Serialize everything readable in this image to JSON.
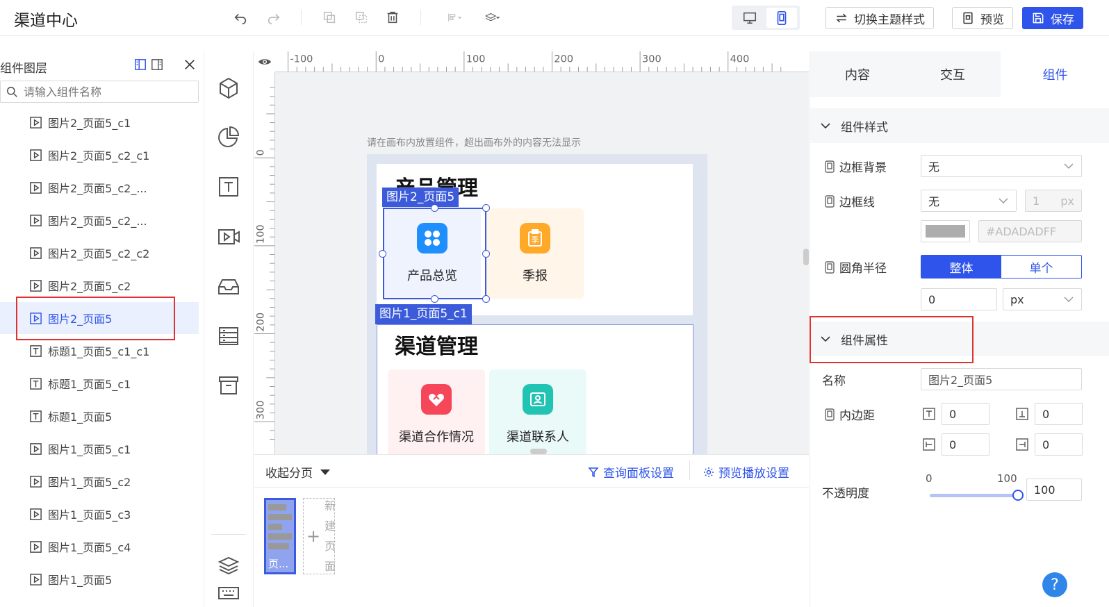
{
  "header": {
    "title": "渠道中心",
    "switch_theme_label": "切换主题样式",
    "preview_label": "预览",
    "save_label": "保存"
  },
  "layers": {
    "title": "组件图层",
    "search_placeholder": "请输入组件名称",
    "items": [
      {
        "label": "图片2_页面5_c1",
        "icon": "image-icon"
      },
      {
        "label": "图片2_页面5_c2_c1",
        "icon": "image-icon"
      },
      {
        "label": "图片2_页面5_c2_...",
        "icon": "image-icon"
      },
      {
        "label": "图片2_页面5_c2_...",
        "icon": "image-icon"
      },
      {
        "label": "图片2_页面5_c2_c2",
        "icon": "image-icon"
      },
      {
        "label": "图片2_页面5_c2",
        "icon": "image-icon"
      },
      {
        "label": "图片2_页面5",
        "icon": "image-icon",
        "selected": true
      },
      {
        "label": "标题1_页面5_c1_c1",
        "icon": "text-icon"
      },
      {
        "label": "标题1_页面5_c1",
        "icon": "text-icon"
      },
      {
        "label": "标题1_页面5",
        "icon": "text-icon"
      },
      {
        "label": "图片1_页面5_c1",
        "icon": "image-icon"
      },
      {
        "label": "图片1_页面5_c2",
        "icon": "image-icon"
      },
      {
        "label": "图片1_页面5_c3",
        "icon": "image-icon"
      },
      {
        "label": "图片1_页面5_c4",
        "icon": "image-icon"
      },
      {
        "label": "图片1_页面5",
        "icon": "image-icon"
      }
    ]
  },
  "canvas": {
    "hint": "请在画布内放置组件，超出画布外的内容无法显示",
    "ruler_h": [
      "-100",
      "0",
      "100",
      "200",
      "300",
      "400"
    ],
    "ruler_v": [
      "0",
      "100",
      "200",
      "300"
    ],
    "card1_title": "产品管理",
    "card2_title": "渠道管理",
    "tiles": [
      "产品总览",
      "季报",
      "渠道合作情况",
      "渠道联系人"
    ],
    "tile_badge": "季",
    "selected_tag": "图片2_页面5",
    "outline_tag": "图片1_页面5_c1"
  },
  "pages": {
    "collapse_label": "收起分页",
    "query_panel_label": "查询面板设置",
    "preview_play_label": "预览播放设置",
    "page_label": "页...",
    "new_page_label": "新建页面"
  },
  "props": {
    "tabs": [
      "内容",
      "交互",
      "组件"
    ],
    "active_tab": 2,
    "section_style": "组件样式",
    "border_bg_label": "边框背景",
    "border_bg_value": "无",
    "border_line_label": "边框线",
    "border_line_value": "无",
    "border_width": "1",
    "border_unit": "px",
    "color_hex": "#ADADADFF",
    "radius_label": "圆角半径",
    "radius_whole": "整体",
    "radius_single": "单个",
    "radius_value": "0",
    "radius_unit": "px",
    "section_attr": "组件属性",
    "name_label": "名称",
    "name_value": "图片2_页面5",
    "padding_label": "内边距",
    "padding": [
      "0",
      "0",
      "0",
      "0"
    ],
    "opacity_label": "不透明度",
    "opacity_min": "0",
    "opacity_max": "100",
    "opacity_value": "100"
  },
  "colors": {
    "accent": "#2f54eb",
    "highlight": "#e03030",
    "swatch": "#ADADAD"
  }
}
